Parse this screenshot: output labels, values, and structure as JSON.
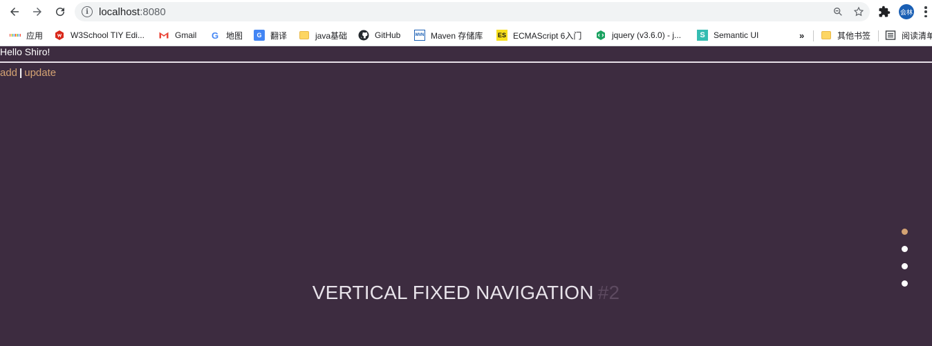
{
  "browser": {
    "url_host": "localhost",
    "url_port": ":8080",
    "avatar_text": "会林"
  },
  "bookmarks": [
    {
      "label": "应用",
      "icon": "apps-grid-icon"
    },
    {
      "label": "W3School TIY Edi...",
      "icon": "w3school-icon"
    },
    {
      "label": "Gmail",
      "icon": "gmail-icon"
    },
    {
      "label": "地图",
      "icon": "google-icon"
    },
    {
      "label": "翻译",
      "icon": "translate-icon"
    },
    {
      "label": "java基础",
      "icon": "folder-icon"
    },
    {
      "label": "GitHub",
      "icon": "github-icon"
    },
    {
      "label": "Maven 存储库",
      "icon": "mvn-icon"
    },
    {
      "label": "ECMAScript 6入门",
      "icon": "es-icon"
    },
    {
      "label": "jquery (v3.6.0) - j...",
      "icon": "jquery-icon"
    },
    {
      "label": "Semantic UI",
      "icon": "semantic-icon"
    },
    {
      "label": "其他书签",
      "icon": "folder-icon"
    },
    {
      "label": "阅读清单",
      "icon": "reading-list-icon"
    }
  ],
  "page": {
    "greeting": "Hello Shiro!",
    "link_add": "add",
    "link_separator": "|",
    "link_update": "update",
    "hero_title": "VERTICAL FIXED NAVIGATION",
    "hero_number": "#2",
    "nav_dots": 4,
    "active_dot": 0
  },
  "colors": {
    "page_background": "#3d2c40",
    "link_accent": "#d4a373",
    "hero_number": "#5d4a60"
  }
}
